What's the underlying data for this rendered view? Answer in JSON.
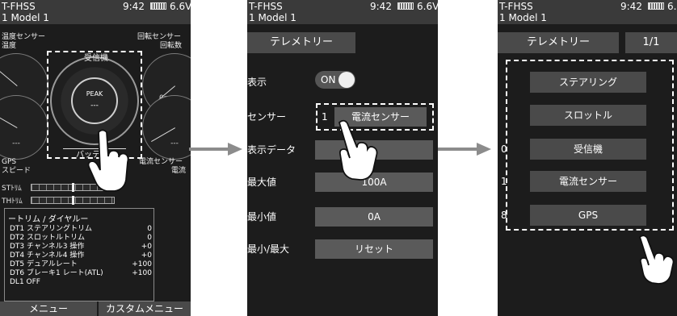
{
  "status": {
    "system": "T-FHSS",
    "time": "9:42",
    "voltage": "6.6V",
    "model": "1    Model 1"
  },
  "screen1": {
    "temp_sensor_label": "温度センサー",
    "temp_label": "温度",
    "rpm_sensor_label": "回転センサー",
    "rpm_label": "回転数",
    "receiver_label": "受信機",
    "peak_label": "PEAK",
    "peak_value": "---",
    "temp_value": "---",
    "rpm_value": "0rpm",
    "gps_label": "GPS",
    "speed_label": "スピード",
    "speed_value": "---",
    "battery_label": "バッテリー",
    "current_sensor_label": "電流センサー",
    "current_label": "電流",
    "current_value": "---",
    "st_trim_label": "STﾄﾘﾑ",
    "th_trim_label": "THﾄﾘﾑ",
    "trim_title": "ートリム / ダイヤルー",
    "trim_rows": [
      {
        "code": "DT1",
        "name": "ステアリングトリム",
        "value": "0"
      },
      {
        "code": "DT2",
        "name": "スロットルトリム",
        "value": "0"
      },
      {
        "code": "DT3",
        "name": "チャンネル3 操作",
        "value": "+0"
      },
      {
        "code": "DT4",
        "name": "チャンネル4 操作",
        "value": "+0"
      },
      {
        "code": "DT5",
        "name": "デュアルレート",
        "value": "+100"
      },
      {
        "code": "DT6",
        "name": "ブレーキ1 レート(ATL)",
        "value": "+100"
      },
      {
        "code": "DL1",
        "name": "OFF",
        "value": ""
      }
    ],
    "menu_button": "メニュー",
    "custom_menu_button": "カスタムメニュー"
  },
  "screen2": {
    "title": "テレメトリー",
    "display_label": "表示",
    "display_value": "ON",
    "sensor_label": "センサー",
    "sensor_slot": "1",
    "sensor_value": "電流センサー",
    "data_label": "表示データ",
    "data_value": "",
    "max_label": "最大値",
    "max_value": "100A",
    "min_label": "最小値",
    "min_value": "0A",
    "minmax_label": "最小/最大",
    "reset_button": "リセット"
  },
  "screen3": {
    "title": "テレメトリー",
    "page": "1/1",
    "items": [
      {
        "slot": "",
        "label": "ステアリング"
      },
      {
        "slot": "",
        "label": "スロットル"
      },
      {
        "slot": "0",
        "label": "受信機"
      },
      {
        "slot": "1",
        "label": "電流センサー"
      },
      {
        "slot": "8",
        "label": "GPS"
      }
    ]
  },
  "colors": {
    "screen_bg": "#1c1c1c",
    "header_bg": "#3a3a3a",
    "button_bg": "#4a4a4a",
    "arrow": "#8c8c8c"
  }
}
